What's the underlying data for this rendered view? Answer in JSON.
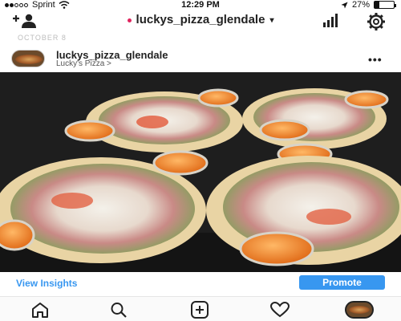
{
  "status_bar": {
    "carrier": "Sprint",
    "time": "12:29 PM",
    "battery": "27%",
    "battery_level": 0.27,
    "signal_dots_filled": 2,
    "signal_dots_total": 5
  },
  "nav": {
    "title": "luckys_pizza_glendale",
    "add_user_icon": "add-user-icon",
    "insights_icon": "bar-chart-icon",
    "settings_icon": "gear-icon",
    "live_dot_color": "#e0245e"
  },
  "feed": {
    "date_label": "OCTOBER 8"
  },
  "post": {
    "username": "luckys_pizza_glendale",
    "location": "Lucky's Pizza >",
    "more_label": "•••",
    "photo_description_icon": "food-photo"
  },
  "actions": {
    "view_insights": "View Insights",
    "promote": "Promote",
    "accent_color": "#3897f0"
  },
  "tabs": [
    {
      "name": "home",
      "icon": "home-icon"
    },
    {
      "name": "search",
      "icon": "search-icon"
    },
    {
      "name": "new-post",
      "icon": "add-post-icon"
    },
    {
      "name": "activity",
      "icon": "heart-icon"
    },
    {
      "name": "profile",
      "icon": "profile-avatar"
    }
  ]
}
